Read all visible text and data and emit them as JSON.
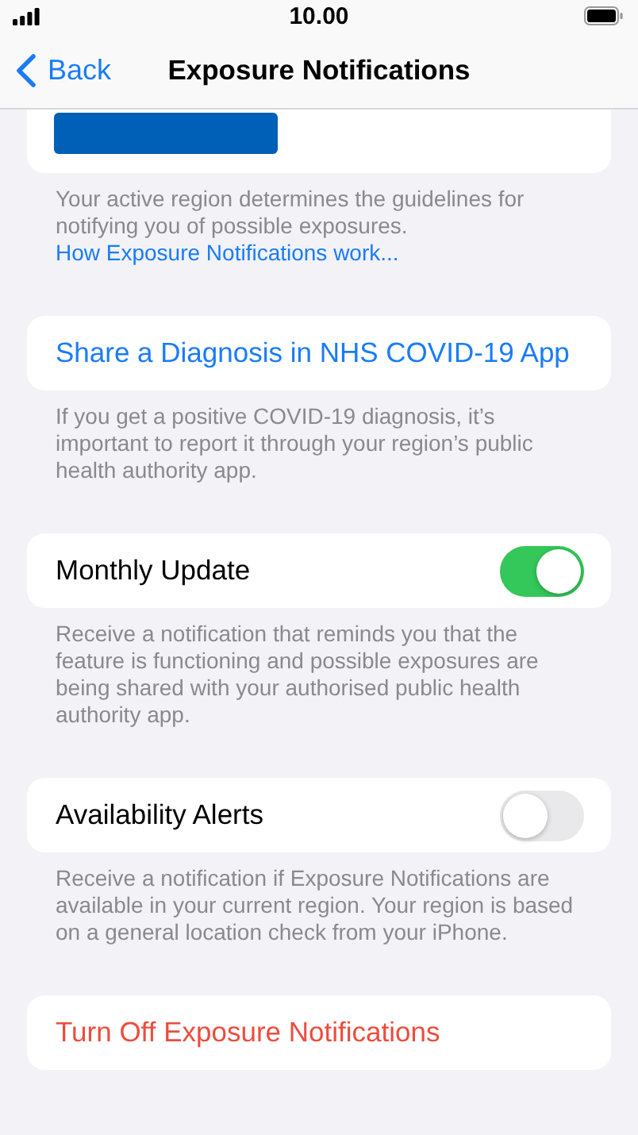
{
  "status_bar": {
    "time": "10.00"
  },
  "nav": {
    "back": "Back",
    "title": "Exposure Notifications"
  },
  "sections": [
    {
      "kind": "redacted",
      "footer": {
        "text": "Your active region determines the guidelines for notifying you of possible exposures. ",
        "link": "How Exposure Notifications work..."
      }
    },
    {
      "kind": "link",
      "label": "Share a Diagnosis in NHS COVID-19 App",
      "footer": {
        "text": "If you get a positive COVID-19 diagnosis, it’s important to report it through your region’s public health authority app."
      }
    },
    {
      "kind": "toggle",
      "label": "Monthly Update",
      "on": true,
      "footer": {
        "text": "Receive a notification that reminds you that the feature is functioning and possible exposures are being shared with your authorised public health authority app."
      }
    },
    {
      "kind": "toggle",
      "label": "Availability Alerts",
      "on": false,
      "footer": {
        "text": "Receive a notification if Exposure Notifications are available in your current region. Your region is based on a general location check from your iPhone."
      }
    },
    {
      "kind": "destructive",
      "label": "Turn Off Exposure Notifications"
    }
  ]
}
